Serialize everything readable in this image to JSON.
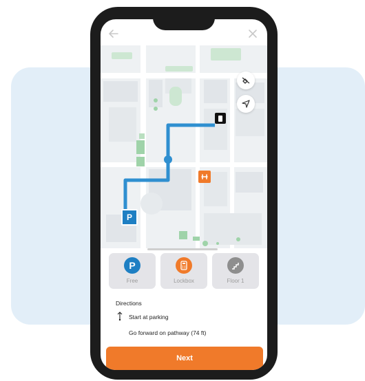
{
  "colors": {
    "accent": "#f07a2a",
    "route": "#2f8fd0",
    "parking": "#1e7fc3",
    "lockbox": "#f07a2a",
    "floor": "#8e8e8e",
    "background_card": "#e2eef8"
  },
  "header": {
    "back_icon": "arrow-left-icon",
    "close_icon": "close-icon"
  },
  "map": {
    "controls": [
      "layers-toggle-icon",
      "locate-me-icon"
    ],
    "markers": {
      "start": "P",
      "destination": "door-icon",
      "poi": "gym-icon"
    }
  },
  "options": [
    {
      "key": "parking",
      "icon": "parking-icon",
      "glyph": "P",
      "label": "Free"
    },
    {
      "key": "lockbox",
      "icon": "lockbox-icon",
      "label": "Lockbox"
    },
    {
      "key": "floor",
      "icon": "stairs-icon",
      "label": "Floor 1"
    }
  ],
  "directions": {
    "title": "Directions",
    "steps": [
      {
        "icon": "start-arrow-icon",
        "text": "Start at parking"
      },
      {
        "icon": "",
        "text": "Go forward on pathway (74 ft)"
      }
    ]
  },
  "footer": {
    "next_label": "Next"
  }
}
